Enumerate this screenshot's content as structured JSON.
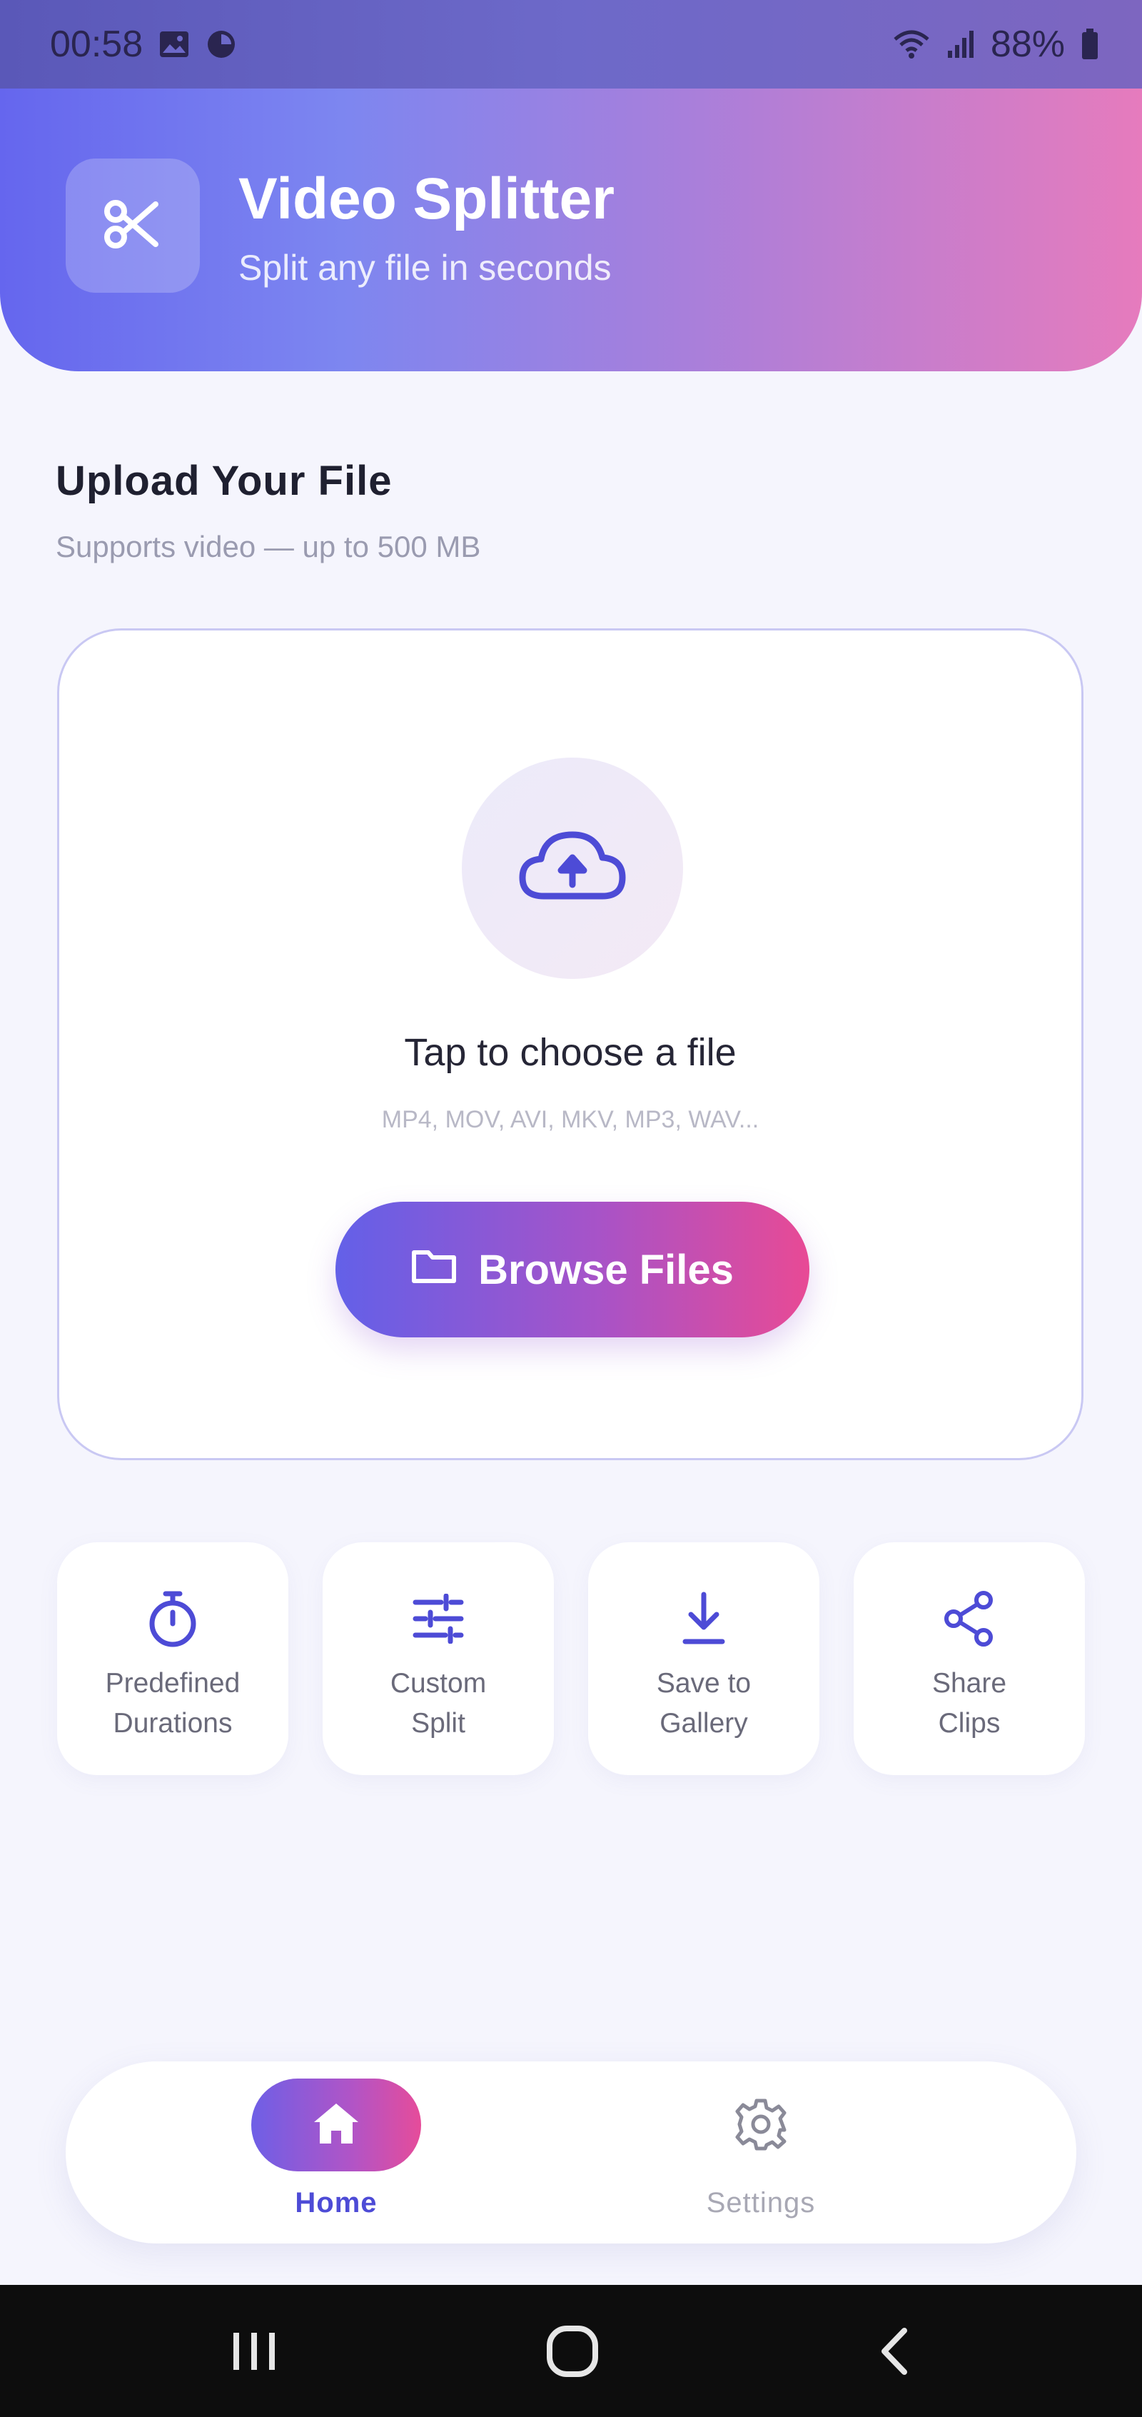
{
  "status_bar": {
    "time": "00:58",
    "battery": "88%",
    "icons": [
      "gallery-icon",
      "data-saver-icon",
      "wifi-icon",
      "signal-icon",
      "battery-icon"
    ]
  },
  "header": {
    "title": "Video Splitter",
    "subtitle": "Split any file in seconds",
    "logo_icon": "scissors-icon"
  },
  "upload": {
    "title": "Upload Your File",
    "subtitle": "Supports video  — up to 500 MB",
    "prompt": "Tap to choose a file",
    "formats": "MP4, MOV, AVI, MKV, MP3, WAV...",
    "button_label": "Browse Files",
    "upload_icon": "cloud-upload-icon",
    "button_icon": "folder-icon"
  },
  "features": [
    {
      "label": "Predefined\nDurations",
      "icon": "timer-icon"
    },
    {
      "label": "Custom\nSplit",
      "icon": "sliders-icon"
    },
    {
      "label": "Save to\nGallery",
      "icon": "download-icon"
    },
    {
      "label": "Share\nClips",
      "icon": "share-icon"
    }
  ],
  "bottom_nav": {
    "home_label": "Home",
    "settings_label": "Settings",
    "active": "Home"
  },
  "colors": {
    "accent": "#4d4bd6",
    "gradient_start": "#6360e8",
    "gradient_end": "#e84a95",
    "background": "#f5f5fd"
  }
}
